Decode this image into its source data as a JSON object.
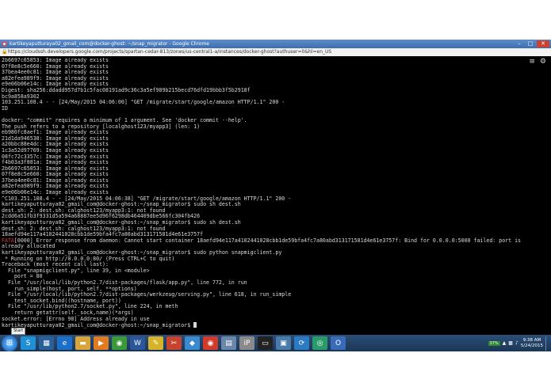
{
  "window": {
    "title": "kartikeyaputturaya02_gmail_com@docker-ghost: ~/snap_migrator - Google Chrome",
    "url": "https://cloudssh.developers.google.com/projects/spartan-cedar-813/zones/us-central1-a/instances/docker-ghost?authuser=0&hl=en_US"
  },
  "terminal": {
    "lines": [
      "2b6697c65853: Image already exists",
      "07f8e8c5e660: Image already exists",
      "37bea4ee0c81: Image already exists",
      "a82efea989f9: Image already exists",
      "e9e06b06e14c: Image already exists",
      "Digest: sha256:ddadd957d7b1c5fac08191ad9c36c3a5ef989b215becd76dfd19bbb3f5b2918f",
      "bc9a858a9302",
      "103.251.108.4 - - [24/May/2015 04:06:00] \"GET /migrate/start/google/amazon HTTP/1.1\" 200 -",
      "ID",
      "",
      "docker: \"commit\" requires a minimum of 1 argument. See 'docker commit --help'.",
      "The push refers to a repository [localghost123/myapp3] (len: 1)",
      "eb980fc8aef1: Image already exists",
      "21d1da946538: Image already exists",
      "a20bbc88e4dc: Image already exists",
      "1c3a52d97769: Image already exists",
      "08fc72c3357c: Image already exists",
      "f4b03a3f881a: Image already exists",
      "2b6697c65853: Image already exists",
      "07f8e8c5e660: Image already exists",
      "37bea4ee0c81: Image already exists",
      "a82efea989f9: Image already exists",
      "e9e06b06e14c: Image already exists",
      "^C103.251.108.4 - - [24/May/2015 04:06:38] \"GET /migrate/start/google/amazon HTTP/1.1\" 200 -",
      "kartikeyaputturaya02_gmail_com@docker-ghost:~/snap_migrator$ sudo sh dest.sh",
      "dest.sh: 2: dest.sh: calghost123/myapp3:1: not found",
      "2cdd6a51fb3f9331d5a594a68887ee5d96f6298db464409dbe566fc304fb426",
      "kartikeyaputturaya02_gmail_com@docker-ghost:~/snap_migrator$ sudo sh dest.sh",
      "dest.sh: 2: dest.sh: calghost123/myapp3:1: not found",
      "18aefd94e117a4102441028cbb1de59bfa4fc7a80abd313171581d4e61e3757f",
      "##ERR##[0000] Error response from daemon: Cannot start container 18aefd94e117a4102441028cbb1de59bfa4fc7a80abd313171581d4e61e3757f: Bind for 0.0.0.0:5000 failed: port is",
      "already allocated",
      "kartikeyaputturaya02_gmail_com@docker-ghost:~/snap_migrator$ sudo python snapmigclient.py",
      " * Running on http://0.0.0.0:80/ (Press CTRL+C to quit)",
      "Traceback (most recent call last):",
      "  File \"snapmigclient.py\", line 39, in <module>",
      "    port = 80",
      "  File \"/usr/local/lib/python2.7/dist-packages/flask/app.py\", line 772, in run",
      "    run_simple(host, port, self, **options)",
      "  File \"/usr/local/lib/python2.7/dist-packages/werkzeug/serving.py\", line 618, in run_simple",
      "    test_socket.bind((hostname, port))",
      "  File \"/usr/lib/python2.7/socket.py\", line 224, in meth",
      "    return getattr(self._sock,name)(*args)",
      "socket.error: [Errno 98] Address already in use",
      "kartikeyaputturaya02_gmail_com@docker-ghost:~/snap_migrator$ "
    ],
    "error_tag": "FATA"
  },
  "taskbar": {
    "start_tooltip": "Start",
    "tray_battery": "37%",
    "time": "9:38 AM",
    "date": "5/24/2015",
    "apps": [
      {
        "icon": "skype-icon",
        "glyph": "S",
        "color": "#1f8fd6"
      },
      {
        "icon": "windows-explorer-icon",
        "glyph": "▦",
        "color": "#2a5f98"
      },
      {
        "icon": "internet-explorer-icon",
        "glyph": "e",
        "color": "#1c6fc9"
      },
      {
        "icon": "folder-icon",
        "glyph": "▬",
        "color": "#d9a43a"
      },
      {
        "icon": "media-player-icon",
        "glyph": "▶",
        "color": "#e07b1f"
      },
      {
        "icon": "chrome-icon",
        "glyph": "◉",
        "color": "#3a9a3a"
      },
      {
        "icon": "word-icon",
        "glyph": "W",
        "color": "#2b579a"
      },
      {
        "icon": "sticky-notes-icon",
        "glyph": "✎",
        "color": "#d6b32a"
      },
      {
        "icon": "snipping-tool-icon",
        "glyph": "✂",
        "color": "#c7432e"
      },
      {
        "icon": "paint-icon",
        "glyph": "◆",
        "color": "#3a8ad0"
      },
      {
        "icon": "chrome-alt-icon",
        "glyph": "◉",
        "color": "#d23a2a"
      },
      {
        "icon": "notepad-icon",
        "glyph": "▤",
        "color": "#6a86a8"
      },
      {
        "icon": "ipix-icon",
        "glyph": "iP",
        "color": "#8a8a8a"
      },
      {
        "icon": "terminal-icon",
        "glyph": "▭",
        "color": "#222"
      },
      {
        "icon": "calculator-icon",
        "glyph": "▣",
        "color": "#4a7ba8"
      },
      {
        "icon": "sync-icon",
        "glyph": "⟳",
        "color": "#2c7bc2"
      },
      {
        "icon": "network-icon",
        "glyph": "◎",
        "color": "#2a9a6a"
      },
      {
        "icon": "outlook-icon",
        "glyph": "O",
        "color": "#3a6bb8"
      }
    ]
  }
}
